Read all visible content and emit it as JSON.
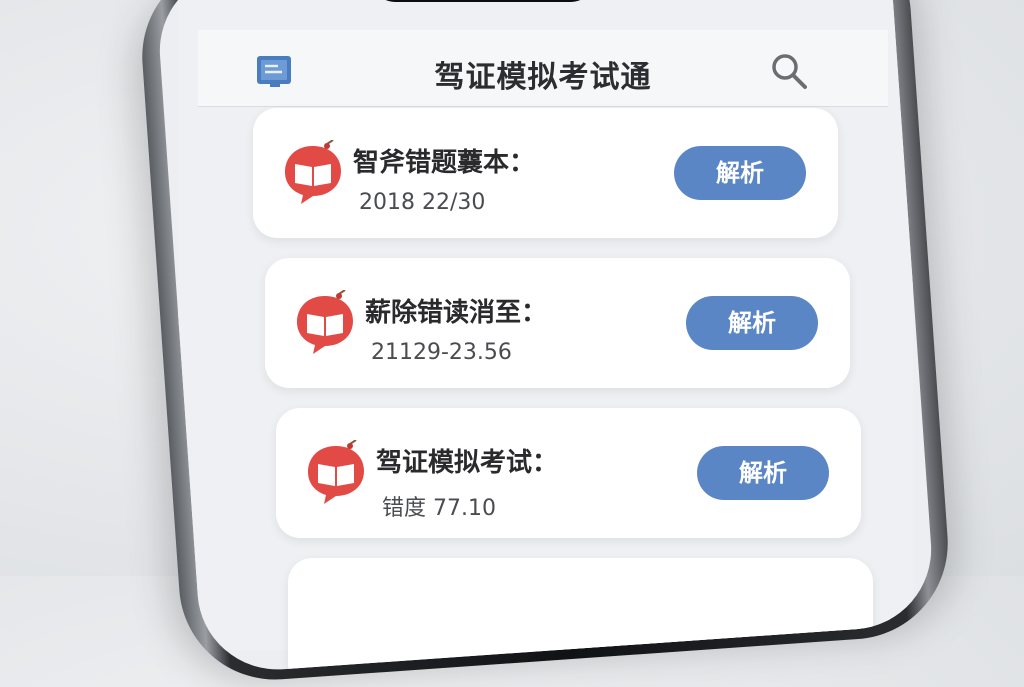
{
  "app": {
    "title": "驾证模拟考试通",
    "menu_icon": "book-icon",
    "search_icon": "search-icon"
  },
  "cards": [
    {
      "icon": "red-book-chat-icon",
      "title": "智斧错题蘘本：",
      "subtitle": "2018 22/30",
      "button_label": "解析"
    },
    {
      "icon": "red-book-chat-icon",
      "title": "薪除错读消至：",
      "subtitle": "21129-23.56",
      "button_label": "解析"
    },
    {
      "icon": "red-book-chat-icon",
      "title": "驾证模拟考试：",
      "subtitle": "错度 77.10",
      "button_label": "解析"
    }
  ],
  "colors": {
    "accent_button": "#5b86c6",
    "icon_red": "#e24a45",
    "book_icon_blue": "#4a7cc0"
  }
}
